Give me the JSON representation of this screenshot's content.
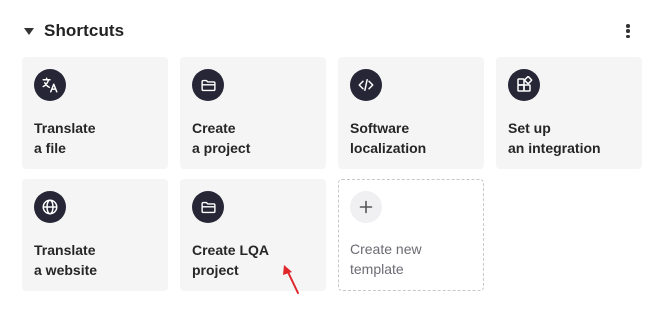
{
  "section": {
    "title": "Shortcuts",
    "collapse_icon": "caret-down-icon",
    "menu_icon": "kebab-menu-icon"
  },
  "cards": [
    {
      "name": "translate-file",
      "label": "Translate\na file",
      "icon": "translate-icon"
    },
    {
      "name": "create-project",
      "label": "Create\na project",
      "icon": "folder-icon"
    },
    {
      "name": "software-localization",
      "label": "Software\nlocalization",
      "icon": "code-icon"
    },
    {
      "name": "setup-integration",
      "label": "Set up\nan integration",
      "icon": "integration-icon"
    },
    {
      "name": "translate-website",
      "label": "Translate\na website",
      "icon": "globe-icon"
    },
    {
      "name": "create-lqa-project",
      "label": "Create LQA project",
      "icon": "folder-icon"
    },
    {
      "name": "create-template",
      "label": "Create new\ntemplate",
      "icon": "plus-icon"
    }
  ],
  "colors": {
    "icon_bg": "#262636",
    "card_bg": "#f5f5f6",
    "annotation_arrow": "#e0262b"
  }
}
